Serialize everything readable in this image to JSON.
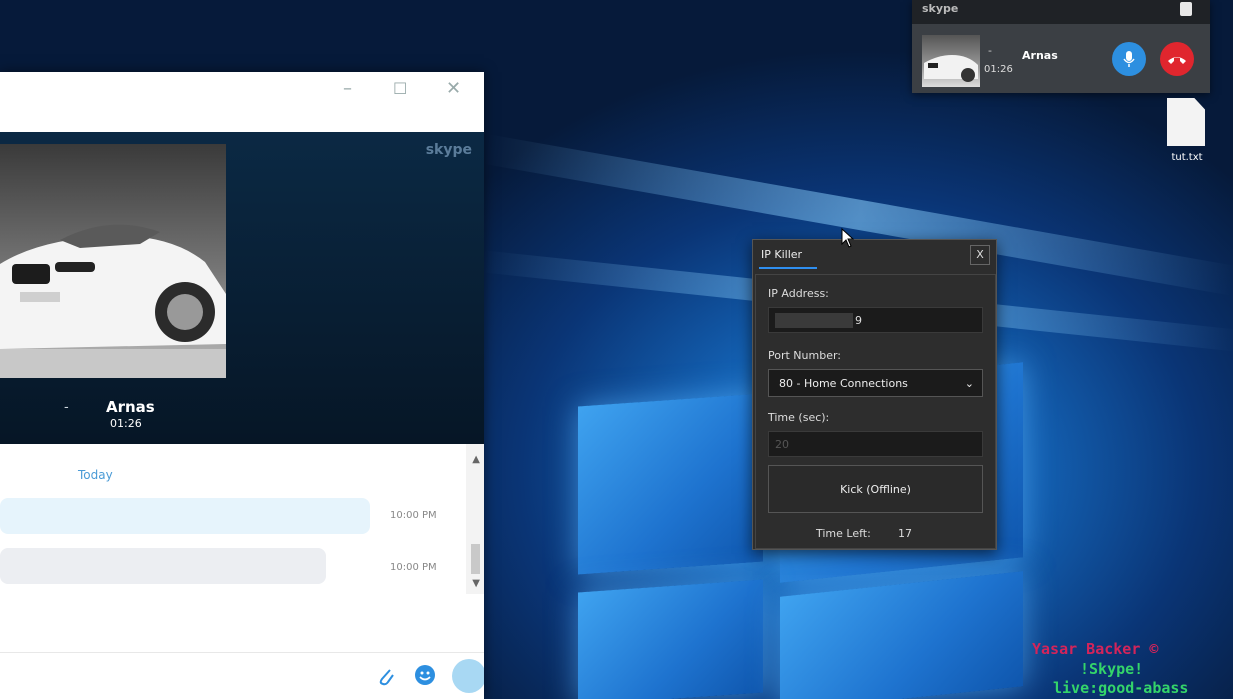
{
  "skype_window": {
    "minimize_icon": "minimize-icon",
    "maximize_icon": "maximize-icon",
    "close_icon": "close-icon",
    "logo_text": "S",
    "caller_dash": "-",
    "caller_name": "Arnas",
    "call_duration": "01:26",
    "chat": {
      "date_separator": "Today",
      "messages": [
        {
          "time": "10:00 PM"
        },
        {
          "time": "10:00 PM"
        }
      ]
    },
    "compose_icons": [
      "paperclip-icon",
      "emoticon-icon",
      "send-icon"
    ]
  },
  "mini_call": {
    "dash": "-",
    "caller_name": "Arnas",
    "call_duration": "01:26",
    "mute_icon": "microphone-icon",
    "hangup_icon": "hang-up-icon",
    "mute_color": "#2d8fe0",
    "hangup_color": "#e0262e"
  },
  "desktop_file": {
    "label": "tut.txt"
  },
  "ip_killer": {
    "title": "IP Killer",
    "close_label": "X",
    "ip_label": "IP Address:",
    "ip_value_suffix": "9",
    "port_label": "Port Number:",
    "port_selected": "80 - Home Connections",
    "time_label": "Time (sec):",
    "time_value": "20",
    "kick_button": "Kick (Offline)",
    "time_left_label": "Time Left:",
    "time_left_value": "17"
  },
  "watermark": {
    "line1": "Yasar Backer ©",
    "line2": "!Skype!",
    "line3": "live:good-abass"
  }
}
